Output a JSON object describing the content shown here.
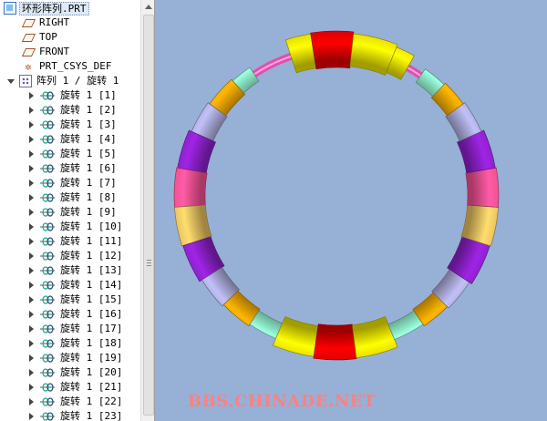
{
  "tree": {
    "root_label": "环形阵列.PRT",
    "datums": [
      {
        "label": "RIGHT",
        "icon": "datum-plane-icon"
      },
      {
        "label": "TOP",
        "icon": "datum-plane-icon"
      },
      {
        "label": "FRONT",
        "icon": "datum-plane-icon"
      },
      {
        "label": "PRT_CSYS_DEF",
        "icon": "csys-icon"
      }
    ],
    "pattern_label": "阵列 1 / 旋转 1",
    "members": [
      "旋转 1 [1]",
      "旋转 1 [2]",
      "旋转 1 [3]",
      "旋转 1 [4]",
      "旋转 1 [5]",
      "旋转 1 [6]",
      "旋转 1 [7]",
      "旋转 1 [8]",
      "旋转 1 [9]",
      "旋转 1 [10]",
      "旋转 1 [11]",
      "旋转 1 [12]",
      "旋转 1 [13]",
      "旋转 1 [14]",
      "旋转 1 [15]",
      "旋转 1 [16]",
      "旋转 1 [17]",
      "旋转 1 [18]",
      "旋转 1 [19]",
      "旋转 1 [20]",
      "旋转 1 [21]",
      "旋转 1 [22]",
      "旋转 1 [23]"
    ]
  },
  "viewport": {
    "background": "#97b0d6",
    "watermark": "BBS.CHINADE.NET",
    "ring_color": "#e050b0",
    "segment_colors": {
      "yellow": "#e8e000",
      "red": "#e00000",
      "orange": "#e8a000",
      "lavender": "#a8a8d8",
      "purple": "#8a20c8",
      "pink": "#f05090",
      "tan": "#e6c060",
      "mint": "#88e0c0"
    }
  }
}
